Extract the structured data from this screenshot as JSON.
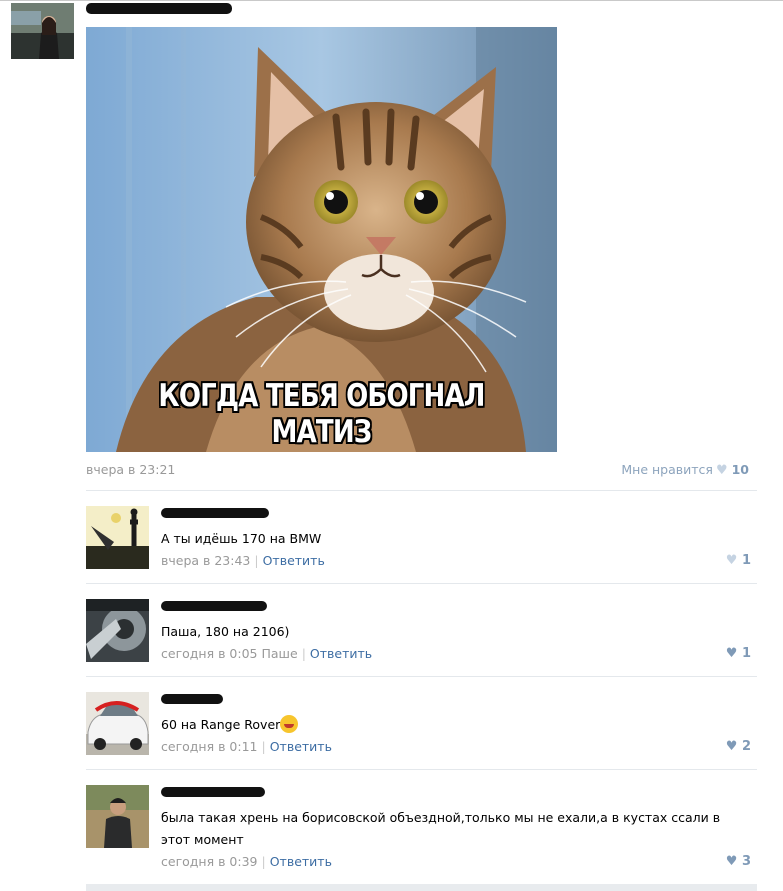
{
  "post": {
    "image_caption": "КОГДА ТЕБЯ ОБОГНАЛ МАТИЗ",
    "time": "вчера в 23:21",
    "like_label": "Мне нравится",
    "like_count": "10"
  },
  "comments": [
    {
      "text": "А ты идёшь 170 на BMW",
      "time": "вчера в 23:43",
      "reply_to": "",
      "reply_label": "Ответить",
      "likes": "1"
    },
    {
      "text": "Паша, 180 на 2106)",
      "time": "сегодня в 0:05",
      "reply_to": "Паше",
      "reply_label": "Ответить",
      "likes": "1"
    },
    {
      "text": "60 на Range Rover",
      "time": "сегодня в 0:11",
      "reply_to": "",
      "reply_label": "Ответить",
      "likes": "2"
    },
    {
      "text": "была такая хрень на борисовской объездной,только мы не ехали,а в кустах ссали в этот момент",
      "time": "сегодня в 0:39",
      "reply_to": "",
      "reply_label": "Ответить",
      "likes": "3"
    }
  ],
  "icons": {
    "heart": "heart-icon",
    "emoji": "laughing-emoji-icon"
  },
  "colors": {
    "link": "#3d6da3",
    "meta": "#999999",
    "like": "#7f9ab7"
  }
}
